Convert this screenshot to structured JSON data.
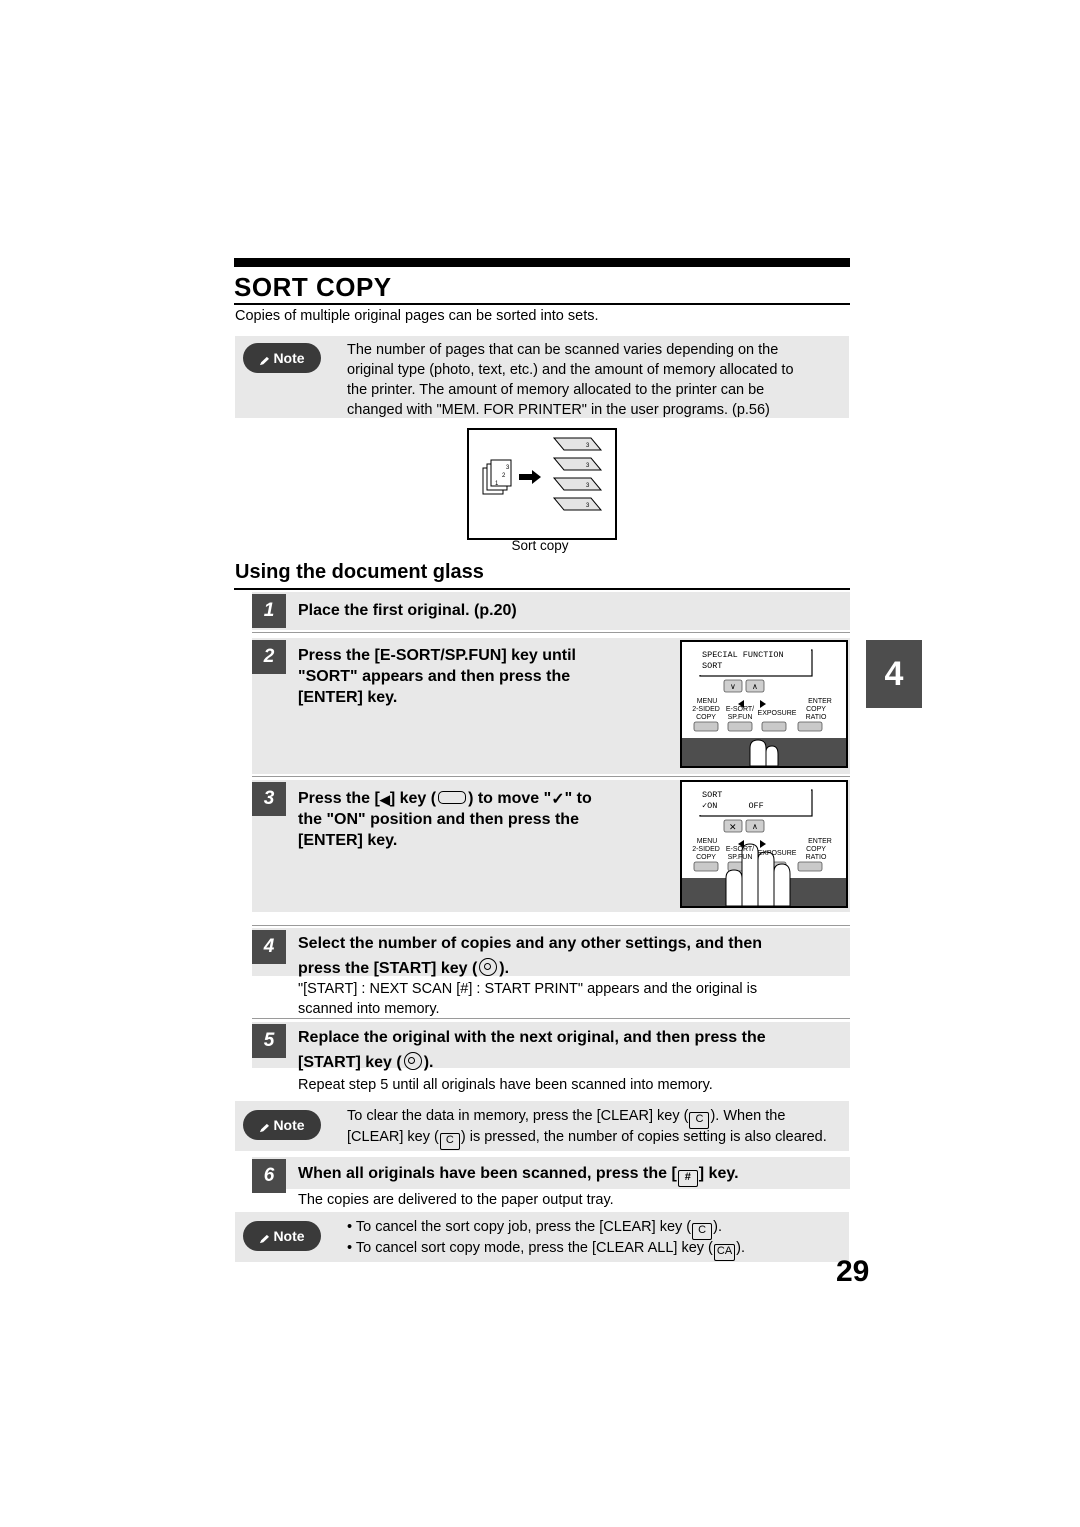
{
  "document": {
    "title": "SORT COPY",
    "intro": "Copies of multiple original pages can be sorted into sets.",
    "page_number": "29"
  },
  "note_top": {
    "label": "Note",
    "line1": "The number of pages that can be scanned varies depending on the",
    "line2": "original type (photo, text, etc.) and the amount of memory allocated to",
    "line3": "the printer. The amount of memory allocated to the printer can be",
    "line4": "changed with \"MEM. FOR PRINTER\" in the user programs. (p.56)"
  },
  "illustration": {
    "caption": "Sort copy",
    "page_labels": [
      "1",
      "2",
      "3"
    ]
  },
  "section": {
    "heading": "Using the document glass"
  },
  "chapter_tab": "4",
  "steps": [
    {
      "number": "1",
      "text": "Place the first original. (p.20)"
    },
    {
      "number": "2",
      "line1": "Press the [E-SORT/SP.FUN] key until",
      "line2": "\"SORT\" appears and then press the",
      "line3": "[ENTER] key."
    },
    {
      "number": "3",
      "line1_a": "Press the [",
      "line1_b": "] key (",
      "line1_c": ") to move \"",
      "line1_d": "\" to",
      "line2": "the \"ON\" position and then press the",
      "line3": "[ENTER] key."
    },
    {
      "number": "4",
      "line1": "Select the number of copies and any other settings, and then",
      "line2_a": "press the [START] key (",
      "line2_b": ").",
      "sub1": "\"[START] : NEXT SCAN  [#] : START PRINT\" appears and the original is",
      "sub2": "scanned into memory."
    },
    {
      "number": "5",
      "line1": "Replace the original with the next original, and then press the",
      "line2_a": "[START] key (",
      "line2_b": ").",
      "sub1": "Repeat step 5 until all originals have been scanned into memory."
    },
    {
      "number": "6",
      "line1_a": "When all originals have been scanned, press the [",
      "line1_b": "] key.",
      "sub1": "The copies are delivered to the paper output tray."
    }
  ],
  "note_mid": {
    "label": "Note",
    "line1_a": "To clear the data in memory, press the [CLEAR] key (",
    "line1_b": "). When the",
    "line2_a": "[CLEAR] key (",
    "line2_b": ") is pressed, the number of copies setting is also cleared.",
    "key_c": "C"
  },
  "note_bottom": {
    "label": "Note",
    "bullet1_a": "To cancel the sort copy job, press the [CLEAR] key (",
    "bullet1_b": ").",
    "bullet2_a": "To cancel sort copy mode, press the [CLEAR ALL] key (",
    "bullet2_b": ").",
    "key_c": "C",
    "key_ca": "CA"
  },
  "panel_step2": {
    "lcd_line1": "SPECIAL FUNCTION",
    "lcd_line2": "SORT",
    "labels": {
      "menu": "MENU",
      "enter": "ENTER",
      "two_sided_copy": [
        "2-SIDED",
        "COPY"
      ],
      "esort_spfun": [
        "E-SORT/",
        "SP.FUN"
      ],
      "exposure": "EXPOSURE",
      "copy_ratio": [
        "COPY",
        "RATIO"
      ]
    }
  },
  "panel_step3": {
    "lcd_line1": "SORT",
    "lcd_line2_on": "ON",
    "lcd_line2_off": "OFF",
    "labels": {
      "menu": "MENU",
      "enter": "ENTER",
      "two_sided_copy": [
        "2-SIDED",
        "COPY"
      ],
      "esort_spfun": [
        "E-SORT/",
        "SP.FUN"
      ],
      "exposure": "EXPOSURE",
      "copy_ratio": [
        "COPY",
        "RATIO"
      ]
    }
  }
}
